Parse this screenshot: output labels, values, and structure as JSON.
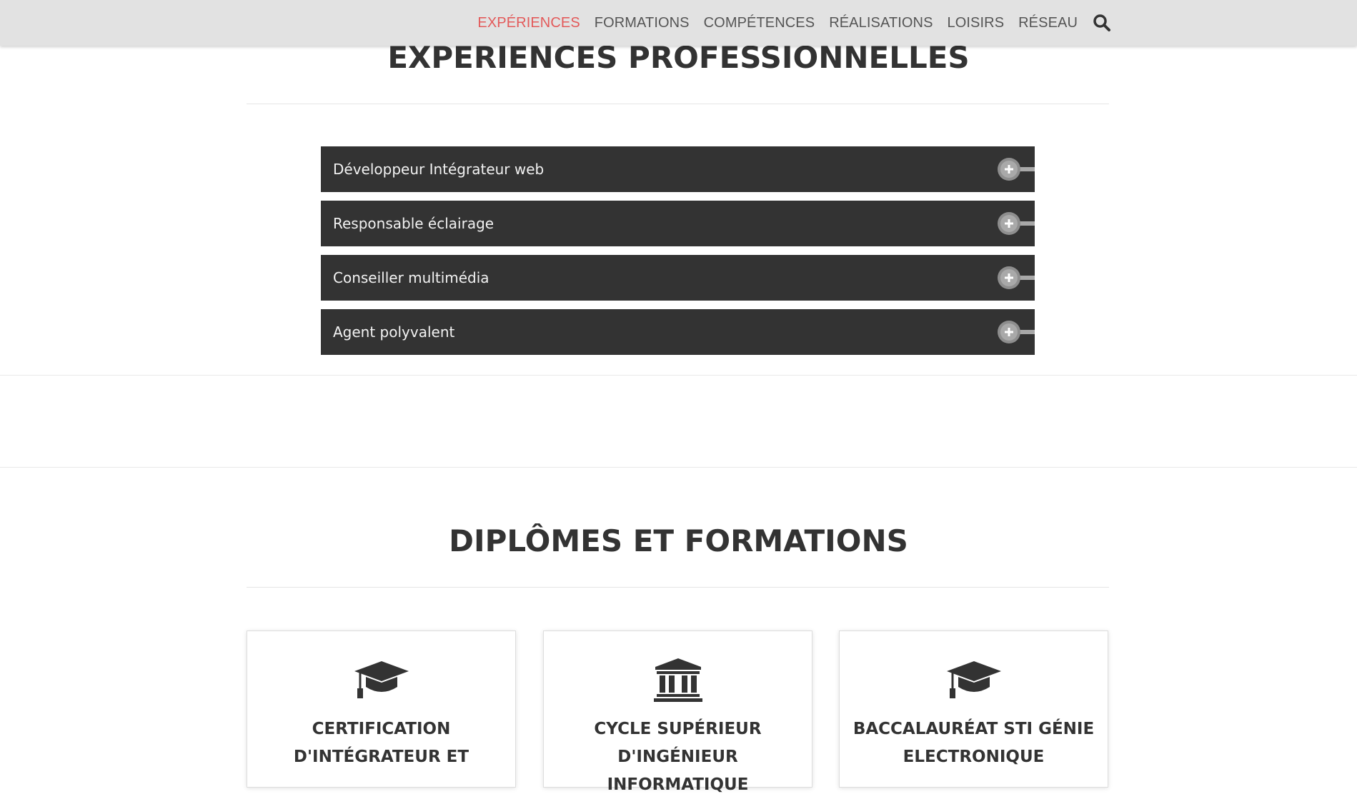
{
  "nav": {
    "items": [
      {
        "label": "EXPÉRIENCES",
        "active": true
      },
      {
        "label": "FORMATIONS",
        "active": false
      },
      {
        "label": "COMPÉTENCES",
        "active": false
      },
      {
        "label": "RÉALISATIONS",
        "active": false
      },
      {
        "label": "LOISIRS",
        "active": false
      },
      {
        "label": "RÉSEAU",
        "active": false
      }
    ],
    "search_icon": "search-icon"
  },
  "experiences": {
    "title": "EXPERIENCES PROFESSIONNELLES",
    "items": [
      {
        "label": "Développeur Intégrateur web"
      },
      {
        "label": "Responsable éclairage"
      },
      {
        "label": "Conseiller multimédia"
      },
      {
        "label": "Agent polyvalent"
      }
    ]
  },
  "formations": {
    "title": "DIPLÔMES ET FORMATIONS",
    "cards": [
      {
        "icon": "graduation-cap-icon",
        "title": "CERTIFICATION D'INTÉGRATEUR ET"
      },
      {
        "icon": "university-icon",
        "title": "CYCLE SUPÉRIEUR D'INGÉNIEUR INFORMATIQUE"
      },
      {
        "icon": "graduation-cap-icon",
        "title": "BACCALAURÉAT STI GÉNIE ELECTRONIQUE"
      }
    ]
  },
  "colors": {
    "accent": "#e35a5a",
    "dark": "#333333",
    "navbar": "#e2e2e2"
  }
}
